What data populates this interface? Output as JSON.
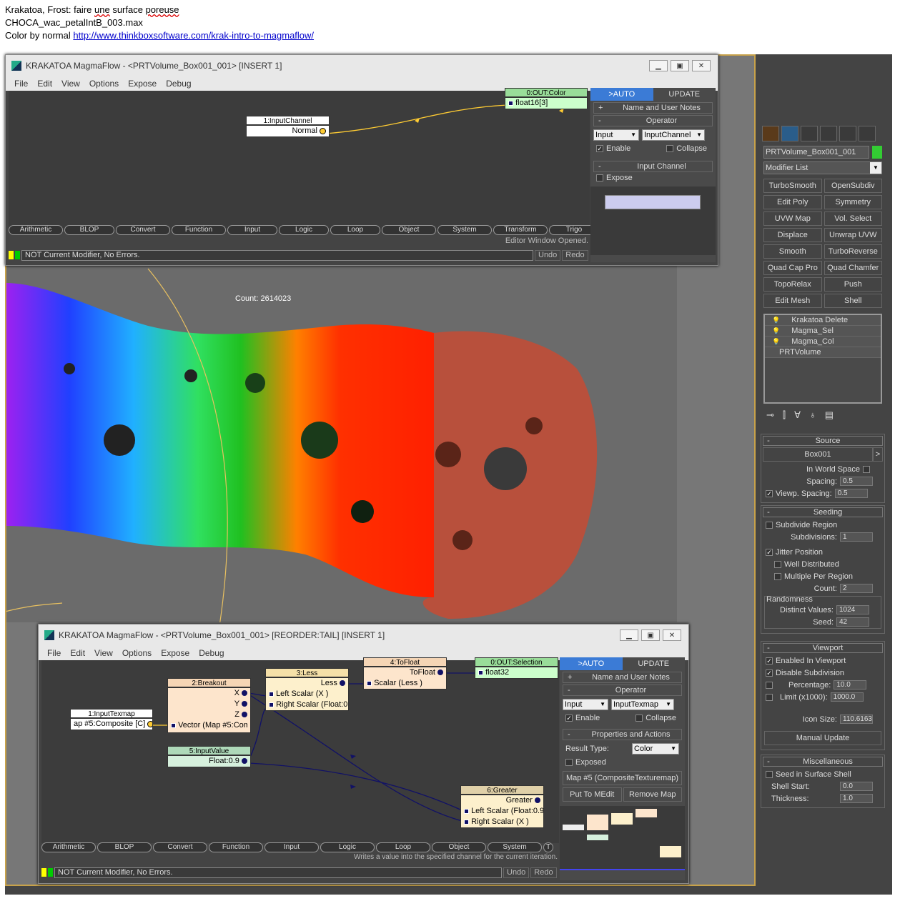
{
  "notes": {
    "line1_a": "Krakatoa, Frost: faire ",
    "line1_b": "une",
    "line1_c": " surface ",
    "line1_d": "poreuse",
    "line2": "CHOCA_wac_petalIntB_003.max",
    "line3_prefix": "Color by normal ",
    "line3_link": "http://www.thinkboxsoftware.com/krak-intro-to-magmaflow/"
  },
  "viewport": {
    "count_label": "Count: 2614023"
  },
  "win1": {
    "title": "KRAKATOA MagmaFlow - <PRTVolume_Box001_001>  [INSERT 1]",
    "menu": [
      "File",
      "Edit",
      "View",
      "Options",
      "Expose",
      "Debug"
    ],
    "nodes": {
      "input_header": "1:InputChannel",
      "input_body": "Normal",
      "out_header": "0:OUT:Color",
      "out_body": "float16[3]"
    },
    "tabs": {
      "auto": ">AUTO",
      "update": "UPDATE"
    },
    "side": {
      "name_notes": "Name and User Notes",
      "operator": "Operator",
      "op_type": "Input",
      "op_sub": "InputChannel",
      "enable": "Enable",
      "collapse": "Collapse",
      "input_channel": "Input Channel",
      "expose": "Expose"
    },
    "categories": [
      "Arithmetic",
      "BLOP",
      "Convert",
      "Function",
      "Input",
      "Logic",
      "Loop",
      "Object",
      "System",
      "Transform",
      "Trigo"
    ],
    "hint": "Editor Window Opened.",
    "status": "NOT Current Modifier, No Errors.",
    "undo": "Undo",
    "redo": "Redo"
  },
  "win2": {
    "title": "KRAKATOA MagmaFlow - <PRTVolume_Box001_001>  [REORDER:TAIL] [INSERT 1]",
    "menu": [
      "File",
      "Edit",
      "View",
      "Options",
      "Expose",
      "Debug"
    ],
    "nodes": {
      "texmap_header": "1:InputTexmap",
      "texmap_body": "ap #5:Composite [C]",
      "breakout_header": "2:Breakout",
      "breakout_x": "X",
      "breakout_y": "Y",
      "breakout_z": "Z",
      "breakout_in": "Vector (Map #5:Comp",
      "less_header": "3:Less",
      "less_out": "Less",
      "less_left": "Left Scalar (X )",
      "less_right": "Right Scalar (Float:0.",
      "tofloat_header": "4:ToFloat",
      "tofloat_out": "ToFloat",
      "tofloat_in": "Scalar (Less )",
      "out_header": "0:OUT:Selection",
      "out_body": "float32",
      "value_header": "5:InputValue",
      "value_body": "Float:0.9",
      "greater_header": "6:Greater",
      "greater_out": "Greater",
      "greater_left": "Left Scalar (Float:0.9",
      "greater_right": "Right Scalar (X )"
    },
    "tabs": {
      "auto": ">AUTO",
      "update": "UPDATE"
    },
    "side": {
      "name_notes": "Name and User Notes",
      "operator": "Operator",
      "op_type": "Input",
      "op_sub": "InputTexmap",
      "enable": "Enable",
      "collapse": "Collapse",
      "props": "Properties and Actions",
      "result_type_label": "Result Type:",
      "result_type": "Color",
      "exposed": "Exposed",
      "map_button": "Map #5 (CompositeTexturemap)",
      "put_medit": "Put To MEdit",
      "remove_map": "Remove Map"
    },
    "categories": [
      "Arithmetic",
      "BLOP",
      "Convert",
      "Function",
      "Input",
      "Logic",
      "Loop",
      "Object",
      "System",
      "T"
    ],
    "hint": "Writes a value into the specified channel for the current iteration.",
    "status": "NOT Current Modifier, No Errors.",
    "undo": "Undo",
    "redo": "Redo"
  },
  "cmd": {
    "object_name": "PRTVolume_Box001_001",
    "modifier_list": "Modifier List",
    "mod_buttons": [
      "TurboSmooth",
      "OpenSubdiv",
      "Edit Poly",
      "Symmetry",
      "UVW Map",
      "Vol. Select",
      "Displace",
      "Unwrap UVW",
      "Smooth",
      "TurboReverse",
      "Quad Cap Pro",
      "Quad Chamfer",
      "TopoRelax",
      "Push",
      "Edit Mesh",
      "Shell"
    ],
    "stack": [
      "Krakatoa Delete",
      "Magma_Sel",
      "Magma_Col",
      "PRTVolume"
    ],
    "source": {
      "header": "Source",
      "object": "Box001",
      "world_space": "In World Space",
      "spacing_label": "Spacing:",
      "spacing": "0.5",
      "viewp_label": "Viewp. Spacing:",
      "viewp": "0.5"
    },
    "seeding": {
      "header": "Seeding",
      "subdivide": "Subdivide Region",
      "subdivisions_label": "Subdivisions:",
      "subdivisions": "1",
      "jitter": "Jitter Position",
      "well": "Well Distributed",
      "multiple": "Multiple Per Region",
      "count_label": "Count:",
      "count": "2",
      "randomness": "Randomness",
      "distinct_label": "Distinct Values:",
      "distinct": "1024",
      "seed_label": "Seed:",
      "seed": "42"
    },
    "viewport": {
      "header": "Viewport",
      "enabled": "Enabled In Viewport",
      "disable_sub": "Disable Subdivision",
      "percentage_label": "Percentage:",
      "percentage": "10.0",
      "limit_label": "Limit (x1000):",
      "limit": "1000.0",
      "icon_label": "Icon Size:",
      "icon": "110.6163",
      "manual_update": "Manual Update"
    },
    "misc": {
      "header": "Miscellaneous",
      "seed_shell": "Seed in Surface Shell",
      "shell_start_label": "Shell Start:",
      "shell_start": "0.0",
      "thickness_label": "Thickness:",
      "thickness": "1.0"
    }
  }
}
